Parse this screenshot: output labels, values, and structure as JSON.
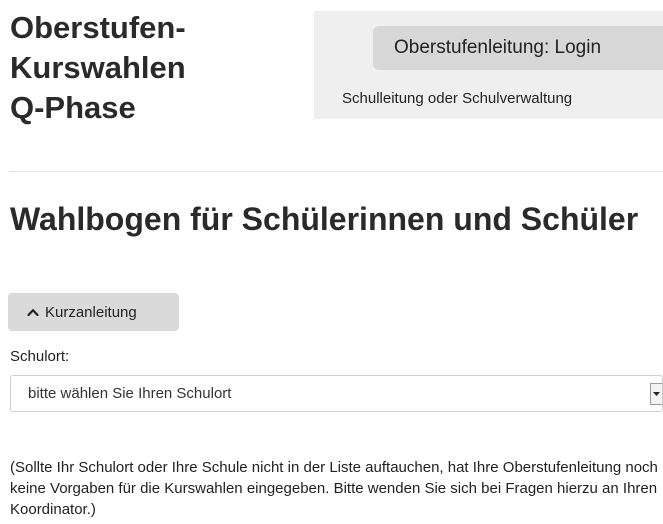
{
  "header": {
    "title_lines": [
      "Oberstufen-",
      "Kurswahlen",
      "Q-Phase"
    ]
  },
  "login": {
    "button_label": "Oberstufenleitung: Login",
    "subtext": "Schulleitung oder Schulverwaltung"
  },
  "form": {
    "title": "Wahlbogen für Schülerinnen und Schüler",
    "instructions_toggle_label": "Kurzanleitung",
    "location_label": "Schulort:",
    "location_select_value": "bitte wählen Sie Ihren Schulort",
    "notice": "(Sollte Ihr Schulort oder Ihre Schule nicht in der Liste auftauchen, hat Ihre Oberstufenleitung noch keine Vorgaben für die Kurswahlen eingegeben. Bitte wenden Sie sich bei Fragen hierzu an Ihren Koordinator.)"
  },
  "icons": {
    "toggle": "chevron-up-icon",
    "select": "caret-down-icon"
  }
}
